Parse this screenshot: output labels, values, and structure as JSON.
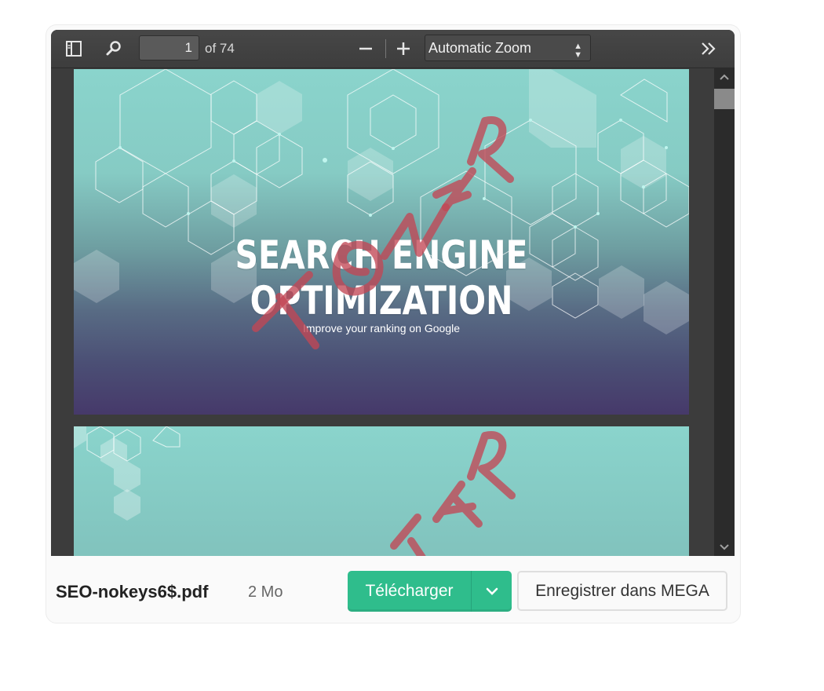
{
  "toolbar": {
    "sidebar_toggle_icon": "sidebar-toggle-icon",
    "search_icon": "search-icon",
    "page_number": "1",
    "page_total": "of 74",
    "zoom_out_icon": "minus-icon",
    "zoom_in_icon": "plus-icon",
    "zoom_value": "Automatic Zoom",
    "more_tools_icon": "double-chevron-right-icon"
  },
  "document": {
    "slide_title": "SEARCH ENGINE OPTIMIZATION",
    "slide_subtitle": "Improve your ranking on Google",
    "colors": {
      "teal": "#8ad4cc",
      "purple": "#46396a",
      "watermark": "#c2555e"
    }
  },
  "footer": {
    "file_name": "SEO-nokeys6$.pdf",
    "file_size": "2 Mo",
    "download_label": "Télécharger",
    "save_label": "Enregistrer dans MEGA",
    "colors": {
      "download": "#2fbd8c"
    }
  }
}
